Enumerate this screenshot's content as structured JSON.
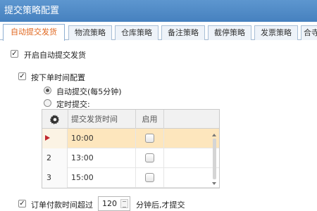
{
  "window": {
    "title": "提交策略配置"
  },
  "tabs": [
    {
      "label": "自动提交发货",
      "active": true
    },
    {
      "label": "物流策略"
    },
    {
      "label": "仓库策略"
    },
    {
      "label": "备注策略"
    },
    {
      "label": "截停策略"
    },
    {
      "label": "发票策略"
    },
    {
      "label": "合寺"
    }
  ],
  "options": {
    "enable_auto_submit": {
      "label": "开启自动提交发货",
      "checked": true
    },
    "by_order_time": {
      "label": "按下单时间配置",
      "checked": true
    },
    "auto_submit_radio": {
      "label": "自动提交(每5分钟)",
      "selected": true
    },
    "scheduled_submit_radio": {
      "label": "定时提交:",
      "selected": false
    },
    "payment_time": {
      "prefix": "订单付款时间超过",
      "value": "120",
      "suffix": "分钟后,才提交",
      "checked": true
    }
  },
  "schedule_grid": {
    "columns": [
      "提交发货时间",
      "启用"
    ],
    "settings_icon": "gear-icon",
    "rows": [
      {
        "row_marker": "current-row-arrow",
        "time": "10:00",
        "enabled": false,
        "selected": true
      },
      {
        "row_number": "2",
        "time": "13:00",
        "enabled": false
      },
      {
        "row_number": "3",
        "time": "15:00",
        "enabled": false
      }
    ]
  },
  "colors": {
    "titlebar": "#4f89c7",
    "active_tab_text": "#e0661d",
    "selected_row": "#fde6bd",
    "row_arrow": "#c0262d"
  }
}
